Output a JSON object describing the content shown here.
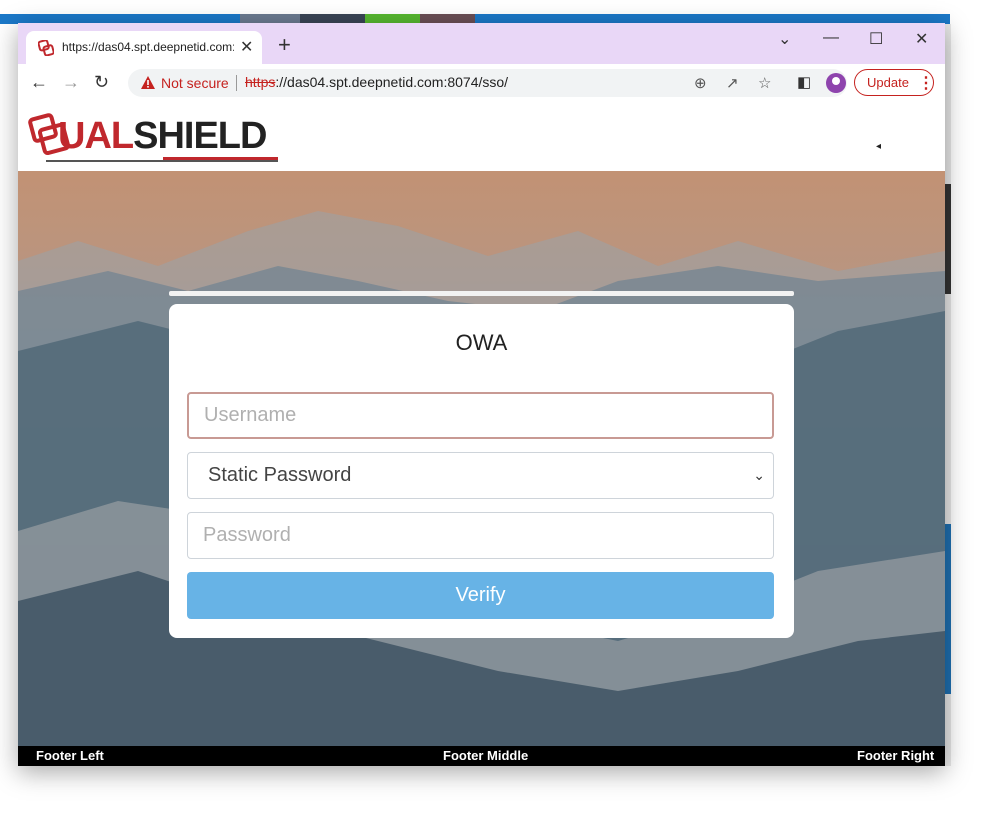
{
  "browser": {
    "tab_title": "https://das04.spt.deepnetid.com:",
    "tab_close": "✕",
    "new_tab": "+",
    "window_controls": {
      "collapse": "⌄",
      "minimize": "—",
      "maximize": "☐",
      "close": "✕"
    },
    "security_label": "Not secure",
    "url_scheme": "https",
    "url_rest": "://das04.spt.deepnetid.com:8074/sso/",
    "update_label": "Update",
    "update_menu": "⋮",
    "icons": [
      "back-icon",
      "forward-icon",
      "reload-icon",
      "warning-icon",
      "zoom-icon",
      "share-icon",
      "star-icon",
      "sidepanel-icon",
      "profile-icon"
    ]
  },
  "header": {
    "logo_prefix": "D",
    "logo_ual": "UAL",
    "logo_shield": "SHIELD",
    "collapse_icon": "◂"
  },
  "login": {
    "title": "OWA",
    "username_placeholder": "Username",
    "method_selected": "Static Password",
    "password_placeholder": "Password",
    "verify_label": "Verify"
  },
  "footer": {
    "left": "Footer Left",
    "middle": "Footer Middle",
    "right": "Footer Right"
  },
  "colors": {
    "tabstrip": "#e9d7f7",
    "brand_red": "#c0282d",
    "verify_button": "#67b3e6",
    "username_border": "#c89a94",
    "not_secure": "#c5221f"
  }
}
